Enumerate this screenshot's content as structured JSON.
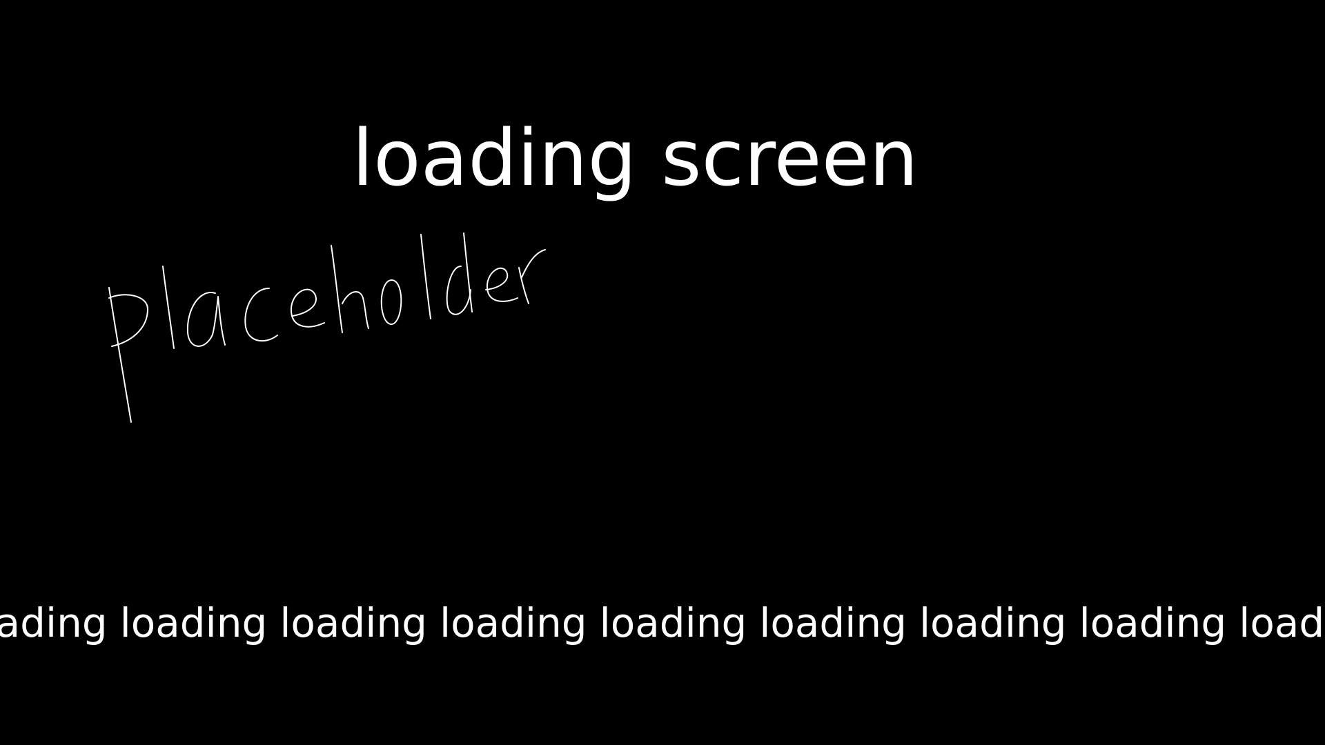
{
  "screen": {
    "title": "loading screen",
    "handwritten_note": "placeholder",
    "ticker_word": "loading",
    "ticker_repeat": 11
  },
  "colors": {
    "background": "#000000",
    "foreground": "#ffffff"
  }
}
